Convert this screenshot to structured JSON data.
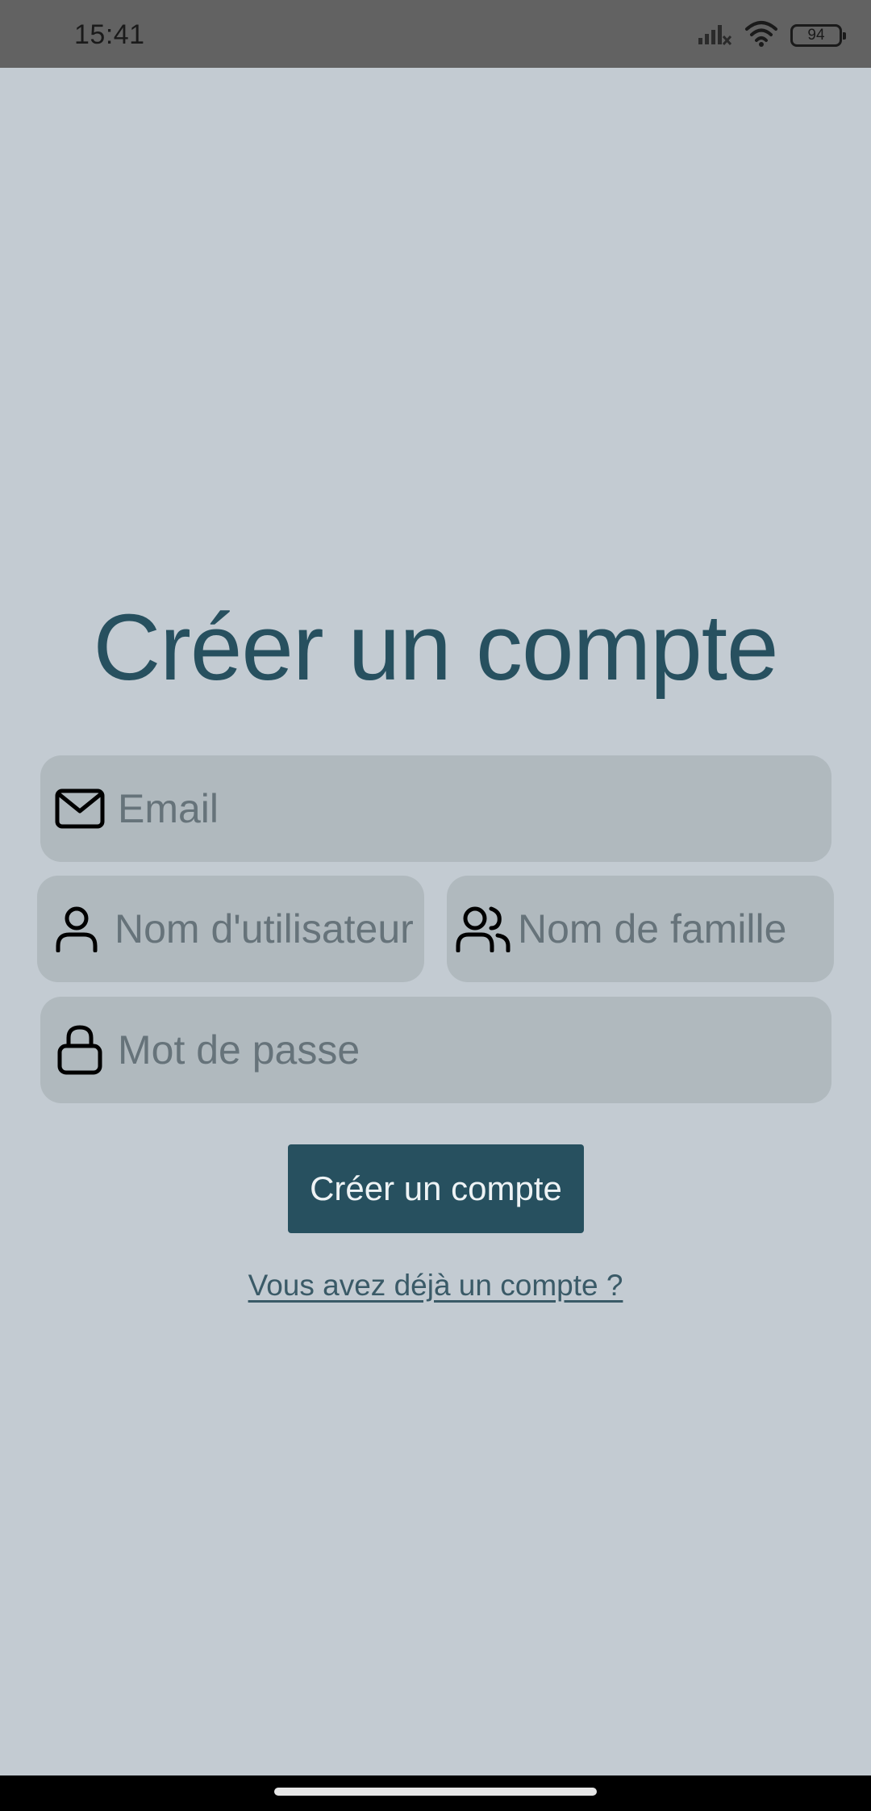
{
  "status_bar": {
    "time": "15:41",
    "battery": "94",
    "icons": [
      "signal-icon",
      "wifi-icon",
      "battery-icon"
    ]
  },
  "form": {
    "title": "Créer un compte",
    "email": {
      "placeholder": "Email",
      "value": "",
      "icon": "mail-icon"
    },
    "username": {
      "placeholder": "Nom d'utilisateur",
      "value": "",
      "icon": "user-icon"
    },
    "family_name": {
      "placeholder": "Nom de famille",
      "value": "",
      "icon": "users-icon"
    },
    "password": {
      "placeholder": "Mot de passe",
      "value": "",
      "icon": "lock-icon"
    },
    "submit_label": "Créer un compte",
    "login_link": "Vous avez déjà un compte ?"
  },
  "colors": {
    "background": "#c3cbd2",
    "accent": "#27505f",
    "field_bg": "#b0b9be",
    "status_bar": "#626262"
  }
}
